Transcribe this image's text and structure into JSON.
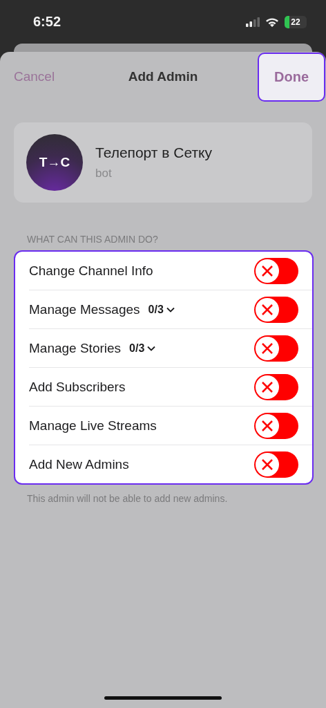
{
  "status_bar": {
    "time": "6:52",
    "battery": "22"
  },
  "nav": {
    "cancel": "Cancel",
    "title": "Add Admin",
    "done": {
      "label": "Done",
      "highlighted": true
    }
  },
  "profile": {
    "avatar_text": "T→C",
    "name": "Телепорт в Сетку",
    "subtitle": "bot"
  },
  "section_header": "WHAT CAN THIS ADMIN DO?",
  "permissions_highlighted": true,
  "permissions": [
    {
      "label": "Change Channel Info",
      "on": false
    },
    {
      "label": "Manage Messages",
      "count": "0/3",
      "expanded": false,
      "on": false
    },
    {
      "label": "Manage Stories",
      "count": "0/3",
      "expanded": false,
      "on": false
    },
    {
      "label": "Add Subscribers",
      "on": false
    },
    {
      "label": "Manage Live Streams",
      "on": false
    },
    {
      "label": "Add New Admins",
      "on": false
    }
  ],
  "footer": "This admin will not be able to add new admins."
}
